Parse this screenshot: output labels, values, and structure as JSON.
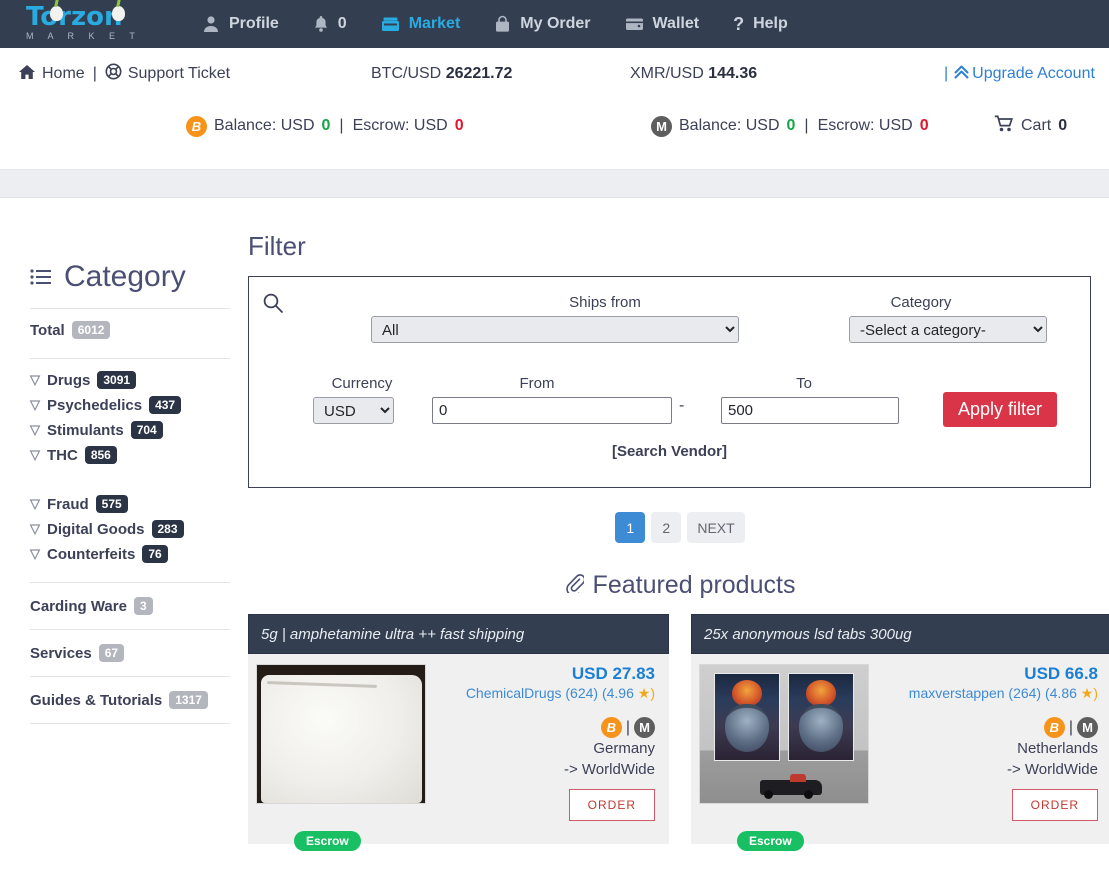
{
  "brand": {
    "name": "Torzon",
    "sub": "M A R K E T",
    "accent": "#29abe2"
  },
  "nav": [
    {
      "label": "Profile",
      "icon": "user-icon",
      "active": false
    },
    {
      "label": "0",
      "icon": "bell-icon",
      "active": false
    },
    {
      "label": "Market",
      "icon": "store-icon",
      "active": true
    },
    {
      "label": "My Order",
      "icon": "bag-icon",
      "active": false
    },
    {
      "label": "Wallet",
      "icon": "wallet-icon",
      "active": false
    },
    {
      "label": "Help",
      "icon": "question-icon",
      "active": false
    }
  ],
  "infobar": {
    "home": "Home",
    "divider": "|",
    "support": "Support Ticket",
    "btc_label": "BTC/USD",
    "btc_value": "26221.72",
    "xmr_label": "XMR/USD",
    "xmr_value": "144.36",
    "upgrade_divider": "|",
    "upgrade": "Upgrade Account",
    "btc_balance_label": "Balance: USD",
    "btc_balance_value": "0",
    "btc_escrow_label": "Escrow: USD",
    "btc_escrow_value": "0",
    "xmr_balance_label": "Balance: USD",
    "xmr_balance_value": "0",
    "xmr_escrow_label": "Escrow: USD",
    "xmr_escrow_value": "0",
    "cart_label": "Cart",
    "cart_count": "0",
    "balance_color": "#17a54a",
    "escrow_color": "#e0172c"
  },
  "sidebar": {
    "title": "Category",
    "total": {
      "label": "Total",
      "count": "6012"
    },
    "groups": [
      [
        {
          "label": "Drugs",
          "count": "3091",
          "expandable": true
        },
        {
          "label": "Psychedelics",
          "count": "437",
          "expandable": true
        },
        {
          "label": "Stimulants",
          "count": "704",
          "expandable": true
        },
        {
          "label": "THC",
          "count": "856",
          "expandable": true
        }
      ],
      [
        {
          "label": "Fraud",
          "count": "575",
          "expandable": true
        },
        {
          "label": "Digital Goods",
          "count": "283",
          "expandable": true
        },
        {
          "label": "Counterfeits",
          "count": "76",
          "expandable": true
        }
      ]
    ],
    "items": [
      {
        "label": "Carding Ware",
        "count": "3"
      },
      {
        "label": "Services",
        "count": "67"
      },
      {
        "label": "Guides & Tutorials",
        "count": "1317"
      }
    ]
  },
  "filter": {
    "title": "Filter",
    "ships_from_label": "Ships from",
    "ships_from_value": "All",
    "category_label": "Category",
    "category_value": "-Select a category-",
    "currency_label": "Currency",
    "currency_value": "USD",
    "from_label": "From",
    "from_value": "0",
    "dash": "-",
    "to_label": "To",
    "to_value": "500",
    "apply_label": "Apply filter",
    "apply_color": "#d93448",
    "vendor_link": "[Search Vendor]"
  },
  "pagination": {
    "pages": [
      "1",
      "2"
    ],
    "next": "NEXT",
    "active": "1",
    "active_color": "#3d8bd4"
  },
  "featured": {
    "heading": "Featured products",
    "products": [
      {
        "title": "5g | amphetamine ultra ++ fast shipping",
        "price": "USD 27.83",
        "vendor": "ChemicalDrugs (624) (4.96",
        "rating_suffix": "★)",
        "escrow": "Escrow",
        "coin_btc": "btc-icon",
        "coin_xmr": "xmr-icon",
        "coin_sep": "|",
        "ships_from": "Germany",
        "ships_to": "-> WorldWide",
        "order": "ORDER"
      },
      {
        "title": "25x anonymous lsd tabs 300ug",
        "price": "USD 66.8",
        "vendor": "maxverstappen (264) (4.86",
        "rating_suffix": "★)",
        "escrow": "Escrow",
        "coin_btc": "btc-icon",
        "coin_xmr": "xmr-icon",
        "coin_sep": "|",
        "ships_from": "Netherlands",
        "ships_to": "-> WorldWide",
        "order": "ORDER"
      }
    ]
  }
}
